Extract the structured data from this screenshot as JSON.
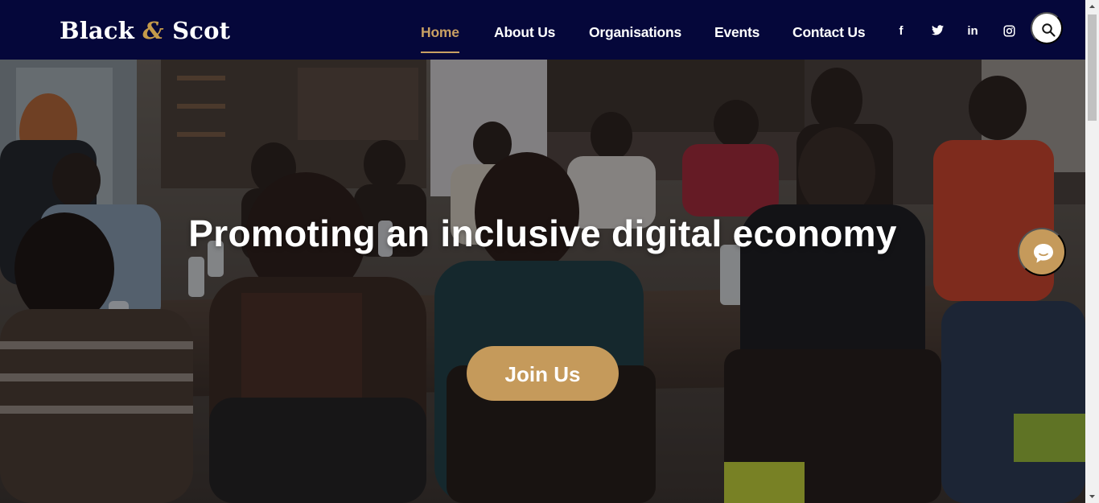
{
  "brand": {
    "name_part1": "Black",
    "ampersand": "&",
    "name_part2": "Scot",
    "accent_color": "#c59a5b",
    "header_color": "#05073a"
  },
  "nav": {
    "items": [
      {
        "label": "Home",
        "active": true
      },
      {
        "label": "About Us",
        "active": false
      },
      {
        "label": "Organisations",
        "active": false
      },
      {
        "label": "Events",
        "active": false
      },
      {
        "label": "Contact Us",
        "active": false
      }
    ],
    "social": [
      {
        "icon": "facebook-icon",
        "glyph": "f"
      },
      {
        "icon": "twitter-icon"
      },
      {
        "icon": "linkedin-icon",
        "glyph": "in"
      },
      {
        "icon": "instagram-icon"
      }
    ],
    "search_icon": "search-icon"
  },
  "hero": {
    "title": "Promoting an inclusive digital economy",
    "cta_label": "Join Us",
    "image_subject": "photo-of-group-meeting-around-tables",
    "chat_icon": "chat-bubble-icon"
  }
}
